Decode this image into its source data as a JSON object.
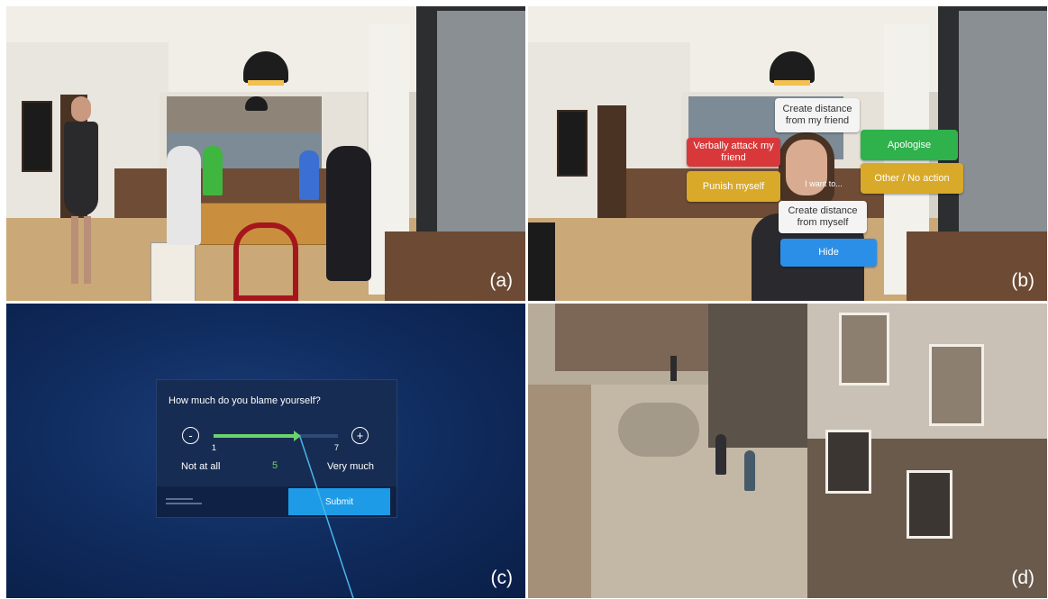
{
  "panels": {
    "a": {
      "label": "(a)"
    },
    "b": {
      "label": "(b)",
      "center_prompt": "I want to...",
      "choices": {
        "create_distance_friend": "Create distance from my friend",
        "verbally_attack": "Verbally attack my friend",
        "apologise": "Apologise",
        "punish_myself": "Punish myself",
        "other_no_action": "Other / No action",
        "create_distance_myself": "Create distance from myself",
        "hide": "Hide"
      }
    },
    "c": {
      "label": "(c)",
      "question": "How much do you blame yourself?",
      "minus": "-",
      "plus": "+",
      "scale_min": "1",
      "scale_max": "7",
      "low_label": "Not at all",
      "high_label": "Very much",
      "value": "5",
      "submit": "Submit"
    },
    "d": {
      "label": "(d)"
    }
  },
  "colors": {
    "red_choice": "#d9383a",
    "green_choice": "#2fb14c",
    "yellow_choice": "#d9a92a",
    "blue_choice": "#2b8fe8",
    "vr_background": "#0f2a5c",
    "slider_fill": "#6dd36d"
  }
}
